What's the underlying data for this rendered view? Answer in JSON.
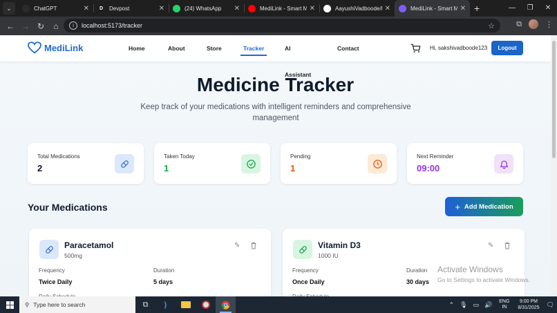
{
  "browser": {
    "tabs": [
      {
        "label": "ChatGPT",
        "fav_color": "#2b2b2b",
        "fav_text": "",
        "active": false
      },
      {
        "label": "Devpost",
        "fav_color": "#1f1f1f",
        "fav_text": "D",
        "active": false
      },
      {
        "label": "(24) WhatsApp",
        "fav_color": "#25d366",
        "fav_text": "",
        "active": false
      },
      {
        "label": "MediLink - Smart Me",
        "fav_color": "#ff0000",
        "fav_text": "",
        "active": false
      },
      {
        "label": "AayushiVadboode/M",
        "fav_color": "#ffffff",
        "fav_text": "",
        "active": false
      },
      {
        "label": "MediLink - Smart Me",
        "fav_color": "#7c5cff",
        "fav_text": "",
        "active": true
      }
    ],
    "url": "localhost:5173/tracker"
  },
  "nav": {
    "brand": "MediLink",
    "links": [
      "Home",
      "About",
      "Store",
      "Tracker",
      "AI Assistant",
      "Contact"
    ],
    "active_link": "Tracker",
    "greeting": "Hi, sakshivadboode123",
    "logout_label": "Logout"
  },
  "hero": {
    "title": "Medicine Tracker",
    "subtitle": "Keep track of your medications with intelligent reminders and comprehensive management"
  },
  "stats": [
    {
      "label": "Total Medications",
      "value": "2",
      "color": "#111827",
      "icon": "pill-icon",
      "icon_bg": "#dbe8fb",
      "icon_color": "#2f6fd6"
    },
    {
      "label": "Taken Today",
      "value": "1",
      "color": "#16a34a",
      "icon": "check-circle-icon",
      "icon_bg": "#d8f5e2",
      "icon_color": "#16a34a"
    },
    {
      "label": "Pending",
      "value": "1",
      "color": "#ea580c",
      "icon": "clock-icon",
      "icon_bg": "#fde9d6",
      "icon_color": "#ea580c"
    },
    {
      "label": "Next Reminder",
      "value": "09:00",
      "color": "#9333ea",
      "icon": "bell-icon",
      "icon_bg": "#f1e1fb",
      "icon_color": "#9333ea"
    }
  ],
  "medications_section": {
    "title": "Your Medications",
    "add_label": "Add Medication"
  },
  "medications": [
    {
      "name": "Paracetamol",
      "dose": "500mg",
      "frequency_label": "Frequency",
      "frequency": "Twice Daily",
      "duration_label": "Duration",
      "duration": "5 days",
      "schedule_label": "Daily Schedule",
      "icon_bg": "#dbe8fb",
      "icon_color": "#2f6fd6"
    },
    {
      "name": "Vitamin D3",
      "dose": "1000 IU",
      "frequency_label": "Frequency",
      "frequency": "Once Daily",
      "duration_label": "Duration",
      "duration": "30 days",
      "schedule_label": "Daily Schedule",
      "icon_bg": "#d8f5e2",
      "icon_color": "#16a34a"
    }
  ],
  "watermark": {
    "line1": "Activate Windows",
    "line2": "Go to Settings to activate Windows."
  },
  "taskbar": {
    "search_placeholder": "Type here to search",
    "lang_line1": "ENG",
    "lang_line2": "IN",
    "time": "9:00 PM",
    "date": "8/31/2025"
  }
}
